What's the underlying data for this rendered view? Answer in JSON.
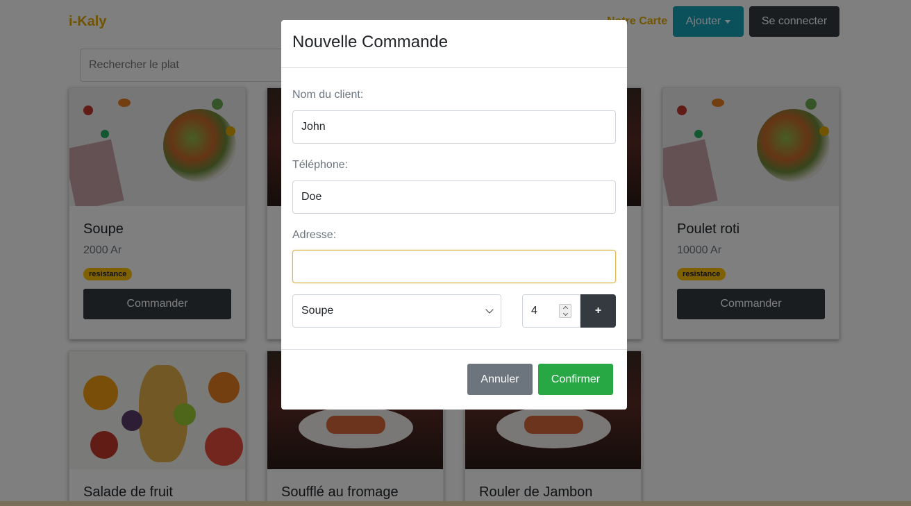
{
  "navbar": {
    "brand": "i-Kaly",
    "menu_link": "Notre Carte",
    "add_button": "Ajouter",
    "login_button": "Se connecter"
  },
  "search": {
    "placeholder": "Rechercher le plat"
  },
  "cards": [
    {
      "title": "Soupe",
      "price": "2000 Ar",
      "badge": "resistance",
      "button": "Commander",
      "image": "salad-bowl"
    },
    {
      "title": "",
      "price": "",
      "badge": "",
      "button": "",
      "image": "plated-dish"
    },
    {
      "title": "",
      "price": "",
      "badge": "",
      "button": "",
      "image": "plated-dish"
    },
    {
      "title": "Poulet roti",
      "price": "10000 Ar",
      "badge": "resistance",
      "button": "Commander",
      "image": "salad-bowl"
    },
    {
      "title": "Salade de fruit",
      "image": "fruit-platter"
    },
    {
      "title": "Soufflé au fromage",
      "image": "plated-dish"
    },
    {
      "title": "Rouler de Jambon",
      "image": "plated-dish"
    }
  ],
  "modal": {
    "title": "Nouvelle Commande",
    "client_label": "Nom du client:",
    "client_value": "John",
    "phone_label": "Téléphone:",
    "phone_value": "Doe",
    "address_label": "Adresse:",
    "address_value": "",
    "dish_select": "Soupe",
    "quantity": "4",
    "add_item_button": "+",
    "cancel_button": "Annuler",
    "confirm_button": "Confirmer"
  },
  "colors": {
    "brand": "#e0a800",
    "info": "#17a2b8",
    "dark": "#343a40",
    "secondary": "#6c757d",
    "success": "#28a745",
    "badge": "#ffc107"
  }
}
